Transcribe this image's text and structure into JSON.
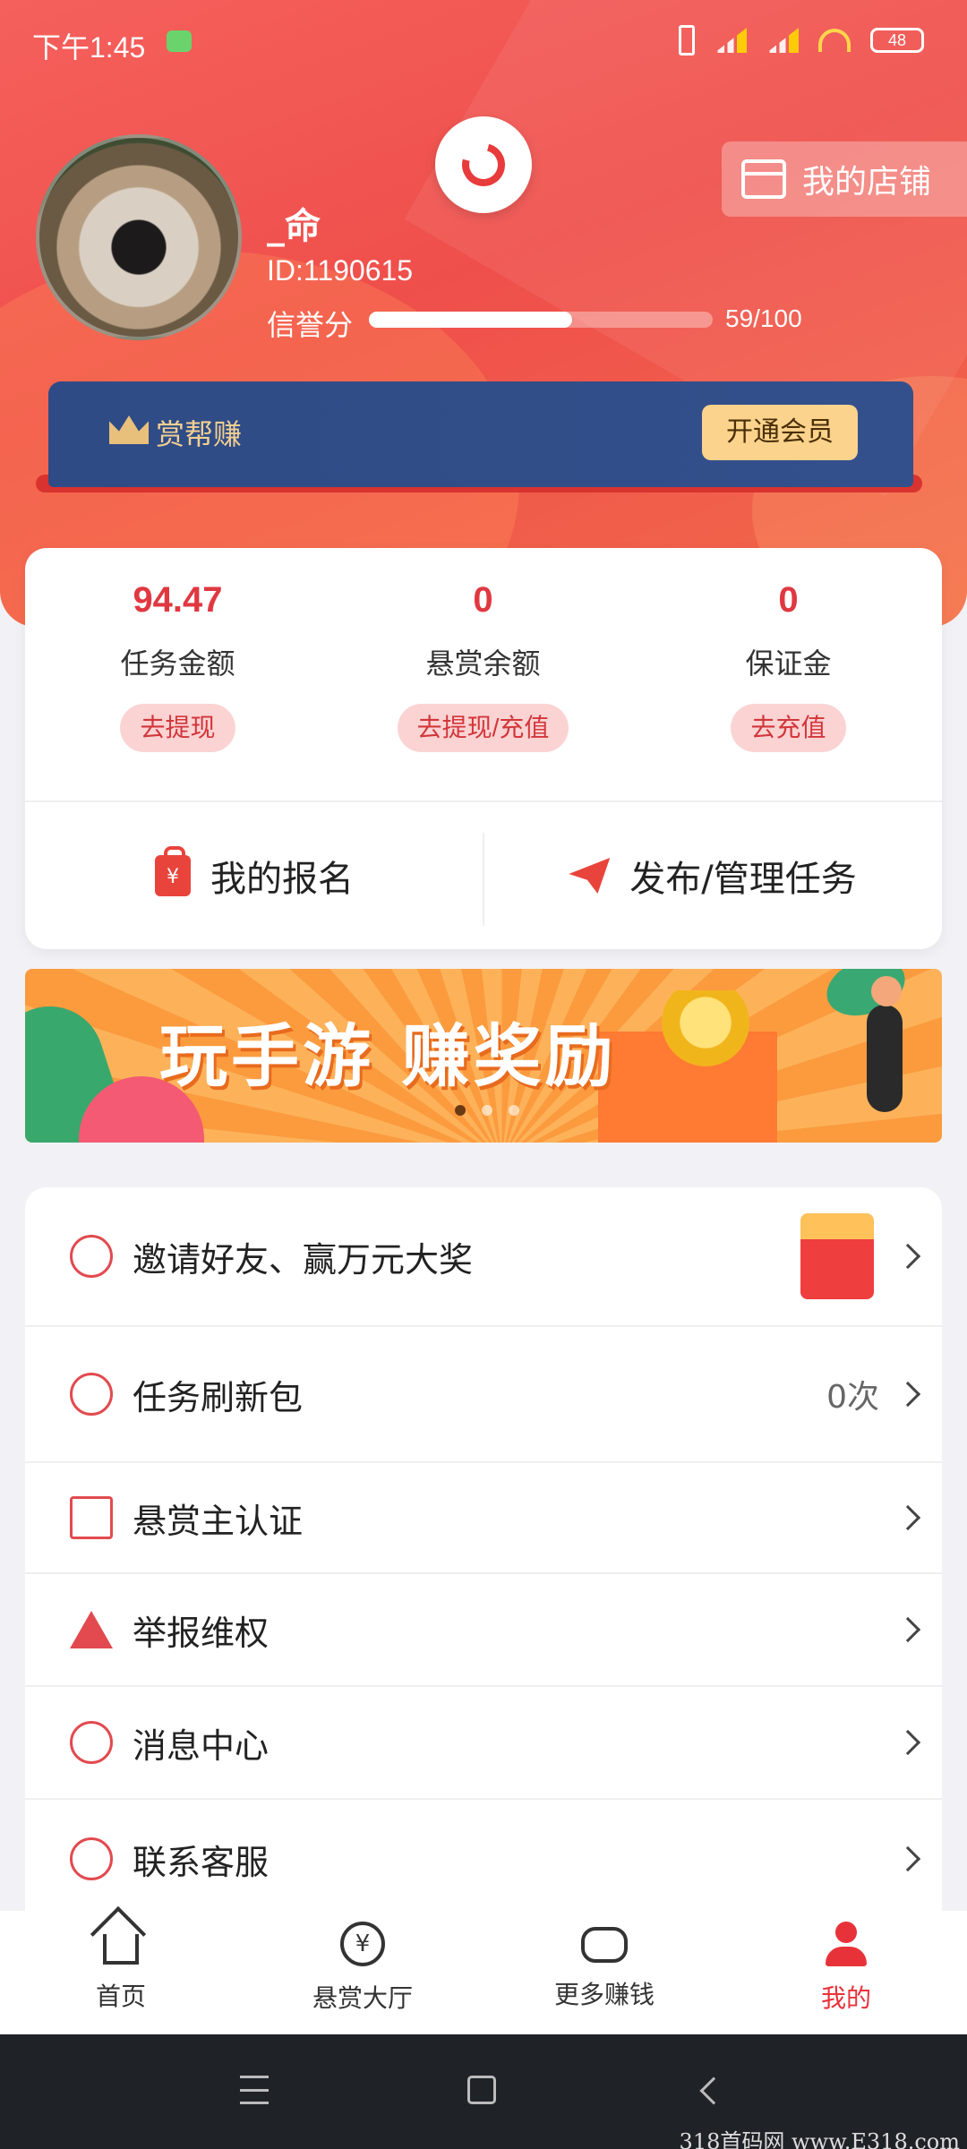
{
  "status_bar": {
    "time": "下午1:45",
    "battery": "48"
  },
  "profile": {
    "username": "_命",
    "id": "ID:1190615",
    "credit_label": "信誉分",
    "credit_value": "59/100",
    "credit_fraction": 0.59,
    "shop_label": "我的店铺"
  },
  "vip": {
    "name": "赏帮赚",
    "button": "开通会员"
  },
  "wallet": {
    "columns": [
      {
        "amount": "94.47",
        "label": "任务金额",
        "button": "去提现"
      },
      {
        "amount": "0",
        "label": "悬赏余额",
        "button": "去提现/充值"
      },
      {
        "amount": "0",
        "label": "保证金",
        "button": "去充值"
      }
    ],
    "actions": [
      {
        "label": "我的报名",
        "icon": "shopping-bag-icon"
      },
      {
        "label": "发布/管理任务",
        "icon": "paper-plane-icon"
      }
    ]
  },
  "banner": {
    "slogan": "玩手游 赚奖励",
    "page_count": 3,
    "active_page": 1
  },
  "menu": [
    {
      "label": "邀请好友、赢万元大奖",
      "value": "",
      "icon": "heart-icon"
    },
    {
      "label": "任务刷新包",
      "value": "0次",
      "icon": "refresh-icon"
    },
    {
      "label": "悬赏主认证",
      "value": "",
      "icon": "envelope-icon"
    },
    {
      "label": "举报维权",
      "value": "",
      "icon": "warning-icon"
    },
    {
      "label": "消息中心",
      "value": "",
      "icon": "message-icon"
    },
    {
      "label": "联系客服",
      "value": "",
      "icon": "customer-service-icon"
    }
  ],
  "tabbar": [
    {
      "label": "首页",
      "icon": "home-icon"
    },
    {
      "label": "悬赏大厅",
      "icon": "yen-icon"
    },
    {
      "label": "更多赚钱",
      "icon": "gamepad-icon"
    },
    {
      "label": "我的",
      "icon": "user-icon",
      "active": true
    }
  ],
  "watermark": "318首码网 www.E318.com",
  "colors": {
    "accent": "#e8323a",
    "vip_bg": "#2f4b85",
    "vip_gold": "#fbd38c"
  }
}
